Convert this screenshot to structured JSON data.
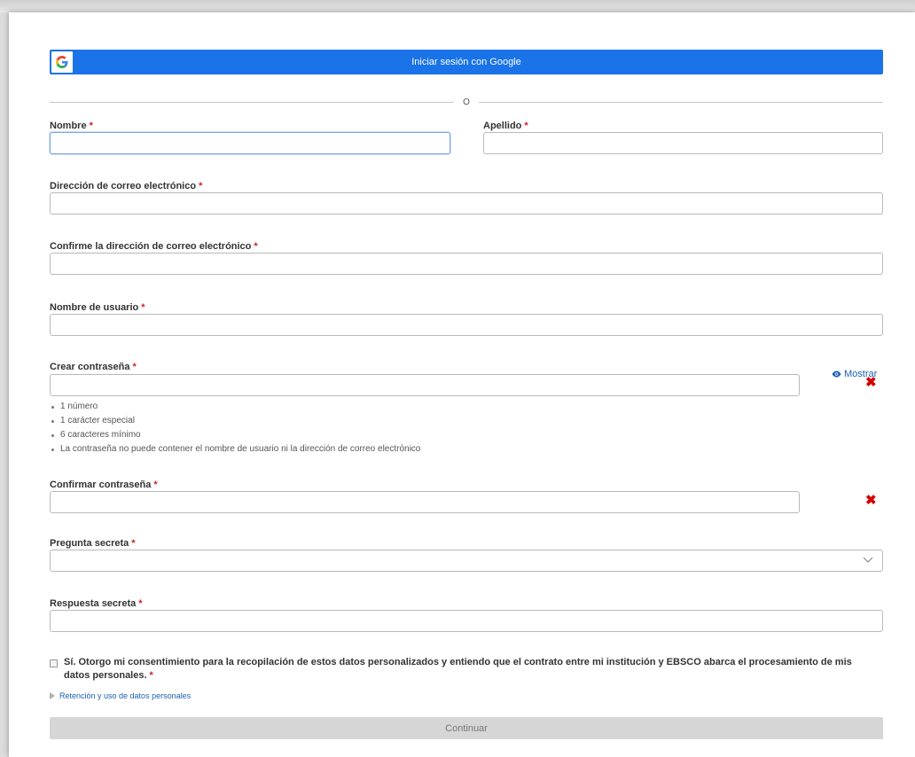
{
  "google": {
    "label": "Iniciar sesión con Google",
    "icon": "google-g-icon"
  },
  "divider": {
    "text": "O"
  },
  "required_mark": "*",
  "fields": {
    "first_name": {
      "label": "Nombre",
      "value": ""
    },
    "last_name": {
      "label": "Apellido",
      "value": ""
    },
    "email": {
      "label": "Dirección de correo electrónico",
      "value": ""
    },
    "email_confirm": {
      "label": "Confirme la dirección de correo electrónico",
      "value": ""
    },
    "username": {
      "label": "Nombre de usuario",
      "value": ""
    },
    "password": {
      "label": "Crear contraseña",
      "value": "",
      "show_label": "Mostrar"
    },
    "password_confirm": {
      "label": "Confirmar contraseña",
      "value": ""
    },
    "secret_question": {
      "label": "Pregunta secreta",
      "selected": ""
    },
    "secret_answer": {
      "label": "Respuesta secreta",
      "value": ""
    }
  },
  "password_rules": [
    "1 número",
    "1 carácter especial",
    "6 caracteres mínimo",
    "La contraseña no puede contener el nombre de usuario ni la dirección de correo electrónico"
  ],
  "consent": {
    "text": "Sí. Otorgo mi consentimiento para la recopilación de estos datos personalizados y entiendo que el contrato entre mi institución y EBSCO abarca el procesamiento de mis datos personales.",
    "checked": false
  },
  "retention_link": "Retención y uso de datos personales",
  "continue_label": "Continuar",
  "colors": {
    "google_blue": "#1a73e8",
    "required_red": "#d21f1f",
    "error_red": "#d10000",
    "link_blue": "#1a5fb4",
    "disabled_button": "#d6d6d6"
  }
}
